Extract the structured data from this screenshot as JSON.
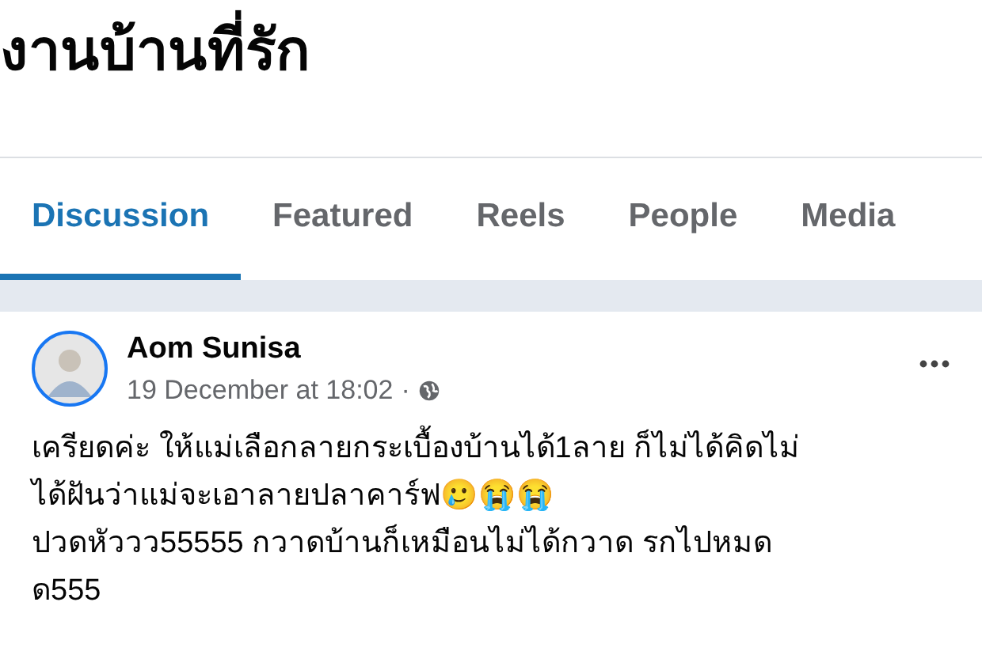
{
  "group": {
    "title": "งานบ้านที่รัก"
  },
  "tabs": [
    {
      "label": "Discussion",
      "selected": true
    },
    {
      "label": "Featured",
      "selected": false
    },
    {
      "label": "Reels",
      "selected": false
    },
    {
      "label": "People",
      "selected": false
    },
    {
      "label": "Media",
      "selected": false
    }
  ],
  "post": {
    "author": "Aom Sunisa",
    "time": "19 December at 18:02",
    "separator": "·",
    "lines": [
      "เครียดค่ะ ให้แม่เลือกลายกระเบื้องบ้านได้1ลาย ก็ไม่ได้คิดไม่",
      "ได้ฝันว่าแม่จะเอาลายปลาคาร์ฟ🥲😭😭",
      "ปวดหัววว55555 กวาดบ้านก็เหมือนไม่ได้กวาด รกไปหมด",
      "ด555"
    ]
  }
}
